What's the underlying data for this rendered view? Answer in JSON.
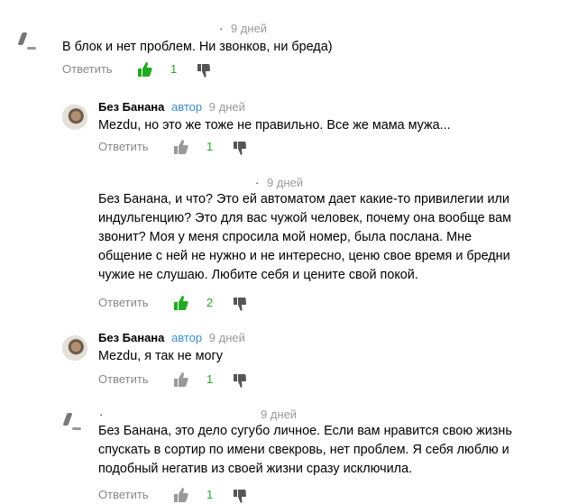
{
  "ui": {
    "reply_label": "Ответить",
    "author_badge": "автор"
  },
  "colors": {
    "like_active": "#22aa22",
    "like_inactive": "#999999",
    "count": "#2aa52a",
    "date": "#999999",
    "badge": "#3b8ecb"
  },
  "comments": [
    {
      "author": "",
      "date": "9 дней",
      "lines": [
        "В блок и нет проблем. Ни звонков, ни бреда)"
      ],
      "likes": "1",
      "liked": true
    },
    {
      "author": "Без Банана",
      "date": "9 дней",
      "lines": [
        "Mezdu, но это же тоже не правильно. Все же мама мужа..."
      ],
      "likes": "1",
      "liked": false
    },
    {
      "author": "",
      "date": "9 дней",
      "lines": [
        "Без Банана, и что? Это ей автоматом дает какие-то привилегии или",
        "индульгенцию? Это для вас чужой человек, почему она вообще вам",
        "звонит? Моя у меня спросила мой номер, была послана. Мне",
        "общение с ней не нужно и не интересно, ценю свое время и бредни",
        "чужие не слушаю. Любите себя и цените свой покой."
      ],
      "likes": "2",
      "liked": true
    },
    {
      "author": "Без Банана",
      "date": "9 дней",
      "lines": [
        "Mezdu, я так не могу"
      ],
      "likes": "1",
      "liked": false
    },
    {
      "author": "",
      "date": "9 дней",
      "lines": [
        "Без Банана, это дело сугубо личное. Если вам нравится свою жизнь",
        "спускать в сортир по имени свекровь, нет проблем. Я себя люблю и",
        "подобный негатив из своей жизни сразу исключила."
      ],
      "likes": "1",
      "liked": false
    }
  ]
}
